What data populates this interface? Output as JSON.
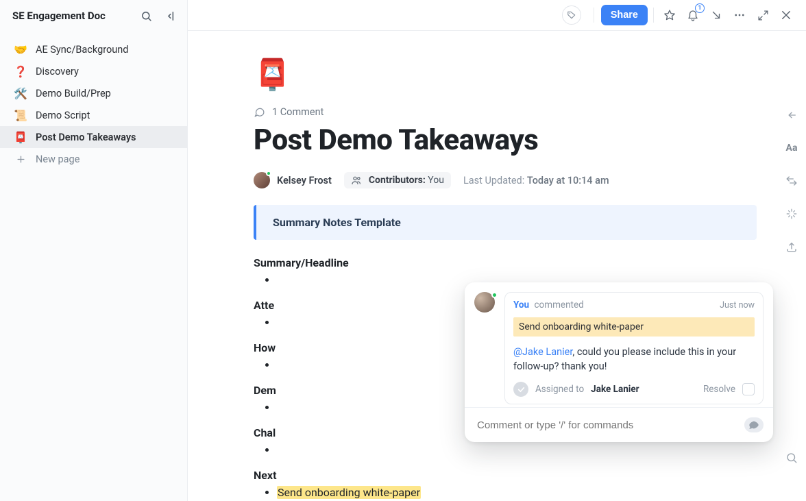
{
  "sidebar": {
    "title": "SE Engagement Doc",
    "items": [
      {
        "emoji": "🤝",
        "label": "AE Sync/Background"
      },
      {
        "emoji": "❓",
        "label": "Discovery"
      },
      {
        "emoji": "🛠️",
        "label": "Demo Build/Prep"
      },
      {
        "emoji": "📜",
        "label": "Demo Script"
      },
      {
        "emoji": "📮",
        "label": "Post Demo Takeaways"
      }
    ],
    "new_page_label": "New page"
  },
  "topbar": {
    "share_label": "Share",
    "notifications_badge": "1"
  },
  "doc": {
    "emoji": "📮",
    "comment_count": "1 Comment",
    "title": "Post Demo Takeaways",
    "author_name": "Kelsey Frost",
    "contributors_label": "Contributors:",
    "contributors_value": "You",
    "last_updated_label": "Last Updated:",
    "last_updated_value": "Today at 10:14 am",
    "callout": "Summary Notes Template",
    "sections": [
      {
        "title": "Summary/Headline"
      },
      {
        "title": "Atte"
      },
      {
        "title": "How"
      },
      {
        "title": "Dem"
      },
      {
        "title": "Chal"
      },
      {
        "title": "Next"
      }
    ],
    "highlighted_item": "Send onboarding white-paper"
  },
  "comment_card": {
    "you_label": "You",
    "action_label": "commented",
    "time_label": "Just now",
    "quoted_text": "Send onboarding white-paper",
    "mention_name": "@Jake Lanier",
    "body_rest": ", could you please include this in your follow-up? thank you!",
    "assigned_to_label": "Assigned to",
    "assigned_to_name": "Jake Lanier",
    "resolve_label": "Resolve",
    "input_placeholder": "Comment or type '/' for commands"
  },
  "right_rail": {
    "aa": "Aa"
  }
}
